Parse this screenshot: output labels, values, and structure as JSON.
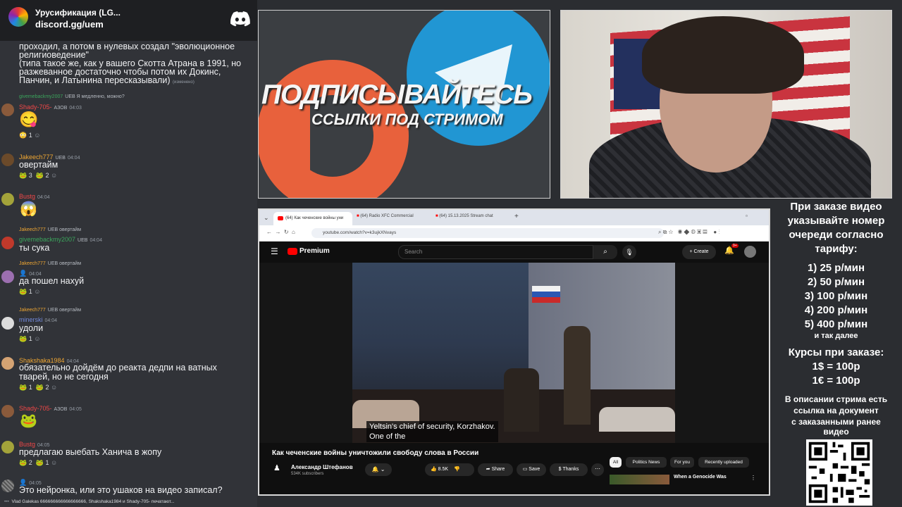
{
  "server": {
    "name": "Урусификация (LG...",
    "link": "discord.gg/uem"
  },
  "chat": {
    "top_message": [
      "проходил, а потом в нулевых создал \"эволюционное",
      "религиоведение\"",
      "(типа такое же, как у вашего Скотта Атрана в 1991, но",
      "разжеванное достаточно чтобы потом их Докинс,",
      "Панчин, и Латынина пересказывали)"
    ],
    "top_message_edited": "(изменено)",
    "messages": [
      {
        "reply_user": "givemebackmy2007",
        "reply_badge": "UEB",
        "reply_text": "Я медленно, можно?",
        "user": "Shady-705-",
        "badge": "АЗОВ",
        "time": "04:03",
        "text": "",
        "reactions": [
          {
            "emoji": "😳",
            "count": "1"
          }
        ]
      },
      {
        "user": "Jakeech777",
        "badge": "UEB",
        "time": "04:04",
        "text": "овертайм",
        "reactions": [
          {
            "emoji": "🐸",
            "count": "3"
          },
          {
            "emoji": "🐸",
            "count": "2"
          }
        ]
      },
      {
        "user": "Bustg",
        "badge": "",
        "time": "04:04",
        "text": "",
        "reactions": []
      },
      {
        "reply_user": "Jakeech777",
        "reply_badge": "UEB",
        "reply_text": "овертайм",
        "user": "givemebackmy2007",
        "badge": "UEB",
        "time": "04:04",
        "text": "ты сука",
        "reactions": []
      },
      {
        "reply_user": "Jakeech777",
        "reply_badge": "UEB",
        "reply_text": "овертайм",
        "user": "",
        "badge": "",
        "time": "04:04",
        "text": "да пошел нахуй",
        "reactions": [
          {
            "emoji": "🐸",
            "count": "1"
          }
        ]
      },
      {
        "reply_user": "Jakeech777",
        "reply_badge": "UEB",
        "reply_text": "овертайм",
        "user": "minerski",
        "badge": "",
        "time": "04:04",
        "text": "удоли",
        "reactions": [
          {
            "emoji": "🐸",
            "count": "1"
          }
        ]
      },
      {
        "user": "Shakshaka1984",
        "badge": "",
        "time": "04:04",
        "text": "обязательно дойдём до реакта дедпи на ватных",
        "text2": "тварей, но не сегодня",
        "reactions": [
          {
            "emoji": "🐸",
            "count": "1"
          },
          {
            "emoji": "🐸",
            "count": "2"
          }
        ]
      },
      {
        "user": "Shady-705-",
        "badge": "АЗОВ",
        "time": "04:05",
        "text": "",
        "reactions": []
      },
      {
        "user": "Bustg",
        "badge": "",
        "time": "04:05",
        "text": "предлагаю выебать Ханича в жопу",
        "reactions": [
          {
            "emoji": "🐸",
            "count": "2"
          },
          {
            "emoji": "🐸",
            "count": "1"
          }
        ]
      },
      {
        "user": "",
        "badge": "",
        "time": "04:05",
        "text": "Это нейронка, или это ушаков на видео записал?",
        "reactions": []
      }
    ],
    "typing": "Vlad Galekas 666666666666666666, Shakshaka1984 и Shady-705- печатают..."
  },
  "promo": {
    "line1": "ПОДПИСЫВАЙТЕСЬ",
    "line2": "ССЫЛКИ ПОД СТРИМОМ"
  },
  "browser": {
    "tabs": [
      "(64) Как чеченские войны уни",
      "(64) Radio XFC Commercial",
      "(64) 15.13.2025 Stream chat"
    ],
    "url": "youtube.com/watch?v=k3ujkXNvays"
  },
  "youtube": {
    "logo": "Premium",
    "search_placeholder": "Search",
    "create": "Create",
    "notif_count": "9+",
    "subtitle1": "Yeltsin's chief of security, Korzhakov.",
    "subtitle2": "One of the",
    "title": "Как чеченские войны уничтожили свободу слова в России",
    "channel": "Александр Штефанов",
    "subs": "534K subscribers",
    "likes": "8.5K",
    "share": "Share",
    "save": "Save",
    "thanks": "Thanks",
    "chips": [
      "All",
      "Politics News",
      "For you",
      "Recently uploaded"
    ],
    "rec_title": "When a Genocide Was"
  },
  "info": {
    "header": [
      "При заказе видео",
      "указывайте номер",
      "очереди согласно",
      "тарифу:"
    ],
    "tariffs": [
      "1) 25 р/мин",
      "2) 50 р/мин",
      "3) 100 р/мин",
      "4) 200 р/мин",
      "5) 400 р/мин"
    ],
    "more": "и так далее",
    "rates_title": "Курсы при заказе:",
    "rates": [
      "1$ = 100р",
      "1€ = 100р"
    ],
    "desc": [
      "В описании стрима есть",
      "ссылка на документ",
      "с заказанными ранее",
      "видео"
    ]
  },
  "colors": {
    "discord_bg": "#313338",
    "yt_red": "#ff0000",
    "telegram_blue": "#2196d3",
    "patreon_orange": "#e8613c"
  }
}
